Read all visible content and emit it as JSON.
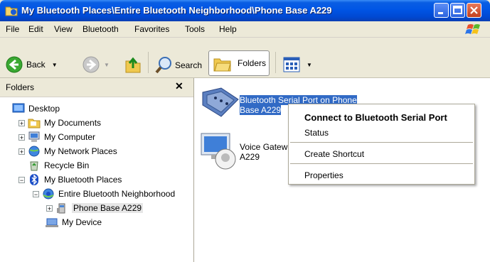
{
  "window": {
    "title": "My Bluetooth Places\\Entire Bluetooth Neighborhood\\Phone Base  A229"
  },
  "menubar": {
    "items": [
      "File",
      "Edit",
      "View",
      "Bluetooth",
      "Favorites",
      "Tools",
      "Help"
    ]
  },
  "toolbar": {
    "back_label": "Back",
    "search_label": "Search",
    "folders_label": "Folders"
  },
  "folders_pane": {
    "title": "Folders",
    "close_glyph": "✕",
    "tree": [
      {
        "label": "Desktop",
        "icon": "desktop-icon"
      },
      {
        "label": "My Documents",
        "icon": "my-documents-icon",
        "expander": "+"
      },
      {
        "label": "My Computer",
        "icon": "my-computer-icon",
        "expander": "+"
      },
      {
        "label": "My Network Places",
        "icon": "network-places-icon",
        "expander": "+"
      },
      {
        "label": "Recycle Bin",
        "icon": "recycle-bin-icon"
      },
      {
        "label": "My Bluetooth Places",
        "icon": "bluetooth-icon",
        "expander": "−"
      },
      {
        "label": "Entire Bluetooth Neighborhood",
        "icon": "bluetooth-neighborhood-icon",
        "expander": "−"
      },
      {
        "label": "Phone Base  A229",
        "icon": "phone-icon",
        "expander": "+",
        "selected": true
      },
      {
        "label": "My Device",
        "icon": "my-device-icon"
      }
    ]
  },
  "content": {
    "items": [
      {
        "line1": "Bluetooth Serial Port on Phone",
        "line2": "Base  A229",
        "icon": "serial-port-icon",
        "selected": true
      },
      {
        "line1": "Voice Gatew",
        "line2": "A229",
        "icon": "voice-gateway-icon"
      }
    ]
  },
  "context_menu": {
    "items": [
      "Connect to Bluetooth Serial Port",
      "Status",
      "Create Shortcut",
      "Properties"
    ]
  },
  "colors": {
    "titlebar": "#0055e5",
    "selection": "#316ac5",
    "chrome": "#ece9d8"
  }
}
